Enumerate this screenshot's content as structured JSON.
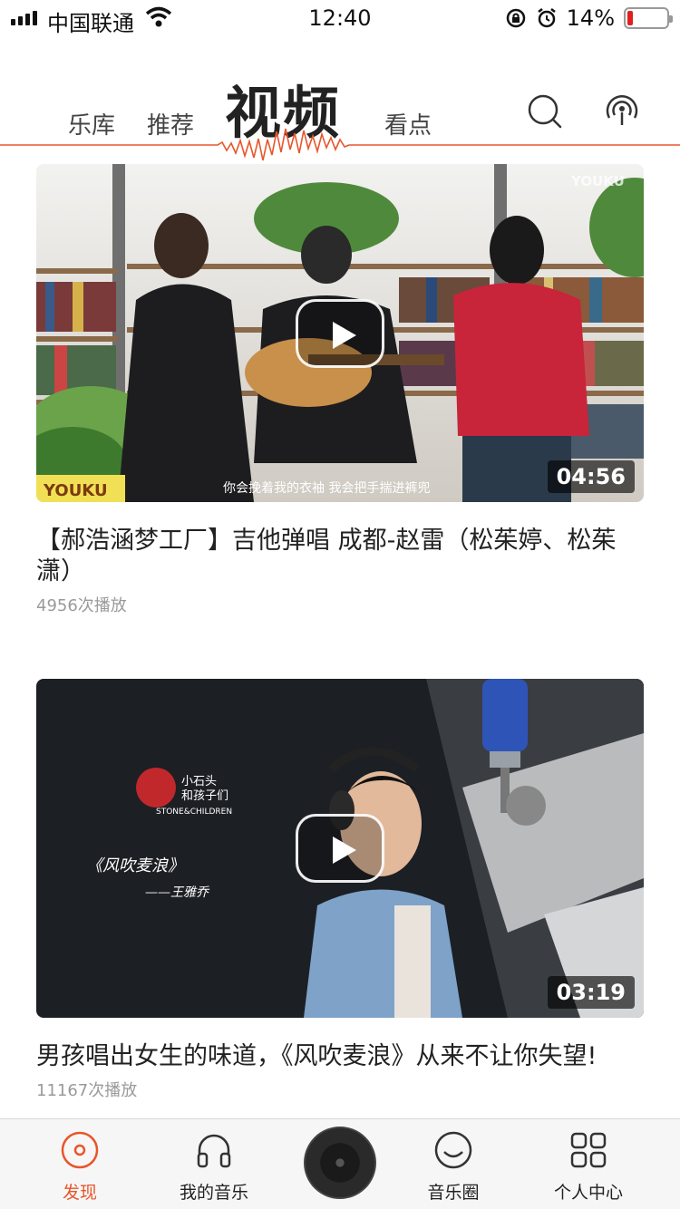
{
  "status": {
    "carrier": "中国联通",
    "time": "12:40",
    "battery": "14%",
    "battery_level": 0.14
  },
  "header": {
    "tabs": [
      {
        "label": "乐库"
      },
      {
        "label": "推荐"
      },
      {
        "label": "视频"
      },
      {
        "label": "看点"
      }
    ],
    "active_tab": "视频",
    "accent_color": "#e8552b"
  },
  "videos": [
    {
      "title": "【郝浩涵梦工厂】吉他弹唱 成都-赵雷（松茱婷、松茱潇）",
      "plays": "4956次播放",
      "duration": "04:56",
      "watermark": "YOUKU",
      "subtitle": "你会挽着我的衣袖 我会把手揣进裤兜"
    },
    {
      "title": "男孩唱出女生的味道，《风吹麦浪》从来不让你失望!",
      "plays": "11167次播放",
      "duration": "03:19",
      "logo_line1": "小石头",
      "logo_line2": "和孩子们",
      "logo_line3": "STONE&CHILDREN",
      "song": "《风吹麦浪》",
      "singer": "——王雅乔"
    }
  ],
  "nav": {
    "items": [
      {
        "label": "发现",
        "icon": "discover-icon"
      },
      {
        "label": "我的音乐",
        "icon": "headphones-icon"
      },
      {
        "label": "音乐圈",
        "icon": "music-circle-icon"
      },
      {
        "label": "个人中心",
        "icon": "grid-icon"
      }
    ]
  }
}
